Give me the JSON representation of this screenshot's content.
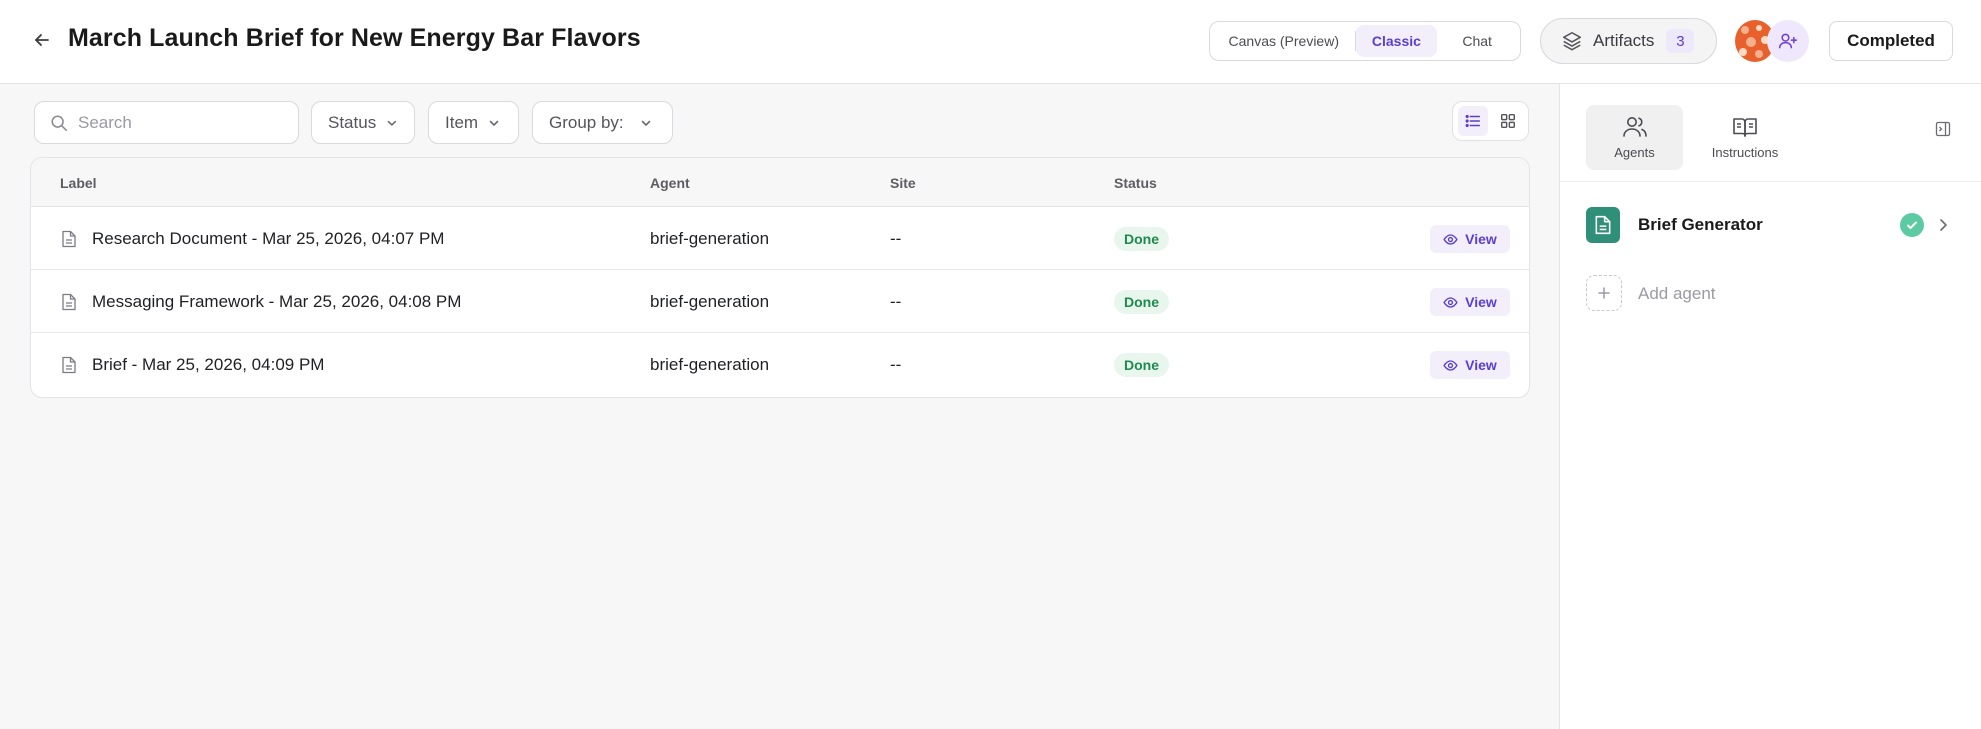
{
  "header": {
    "title": "March Launch Brief for New Energy Bar Flavors",
    "view_options": {
      "canvas": "Canvas (Preview)",
      "classic": "Classic",
      "chat": "Chat"
    },
    "active_view": "Classic",
    "artifacts": {
      "label": "Artifacts",
      "count": "3"
    },
    "status_button": "Completed"
  },
  "filters": {
    "search_placeholder": "Search",
    "status": "Status",
    "item": "Item",
    "group_by": "Group by:"
  },
  "table": {
    "columns": {
      "label": "Label",
      "agent": "Agent",
      "site": "Site",
      "status": "Status"
    },
    "rows": [
      {
        "label": "Research Document - Mar 25, 2026, 04:07 PM",
        "agent": "brief-generation",
        "site": "--",
        "status": "Done",
        "action": "View"
      },
      {
        "label": "Messaging Framework - Mar 25, 2026, 04:08 PM",
        "agent": "brief-generation",
        "site": "--",
        "status": "Done",
        "action": "View"
      },
      {
        "label": "Brief - Mar 25, 2026, 04:09 PM",
        "agent": "brief-generation",
        "site": "--",
        "status": "Done",
        "action": "View"
      }
    ]
  },
  "right_panel": {
    "tabs": {
      "agents": "Agents",
      "instructions": "Instructions"
    },
    "active_tab": "Agents",
    "agents": [
      {
        "name": "Brief Generator",
        "state": "complete"
      }
    ],
    "add_agent_label": "Add agent"
  },
  "colors": {
    "accent": "#5b3fd0",
    "accent_bg": "#f2effb",
    "done_text": "#1e8a4f",
    "done_bg": "#e8f6ee",
    "agent_icon_bg": "#2f8f78",
    "check_green": "#5ccba3"
  }
}
